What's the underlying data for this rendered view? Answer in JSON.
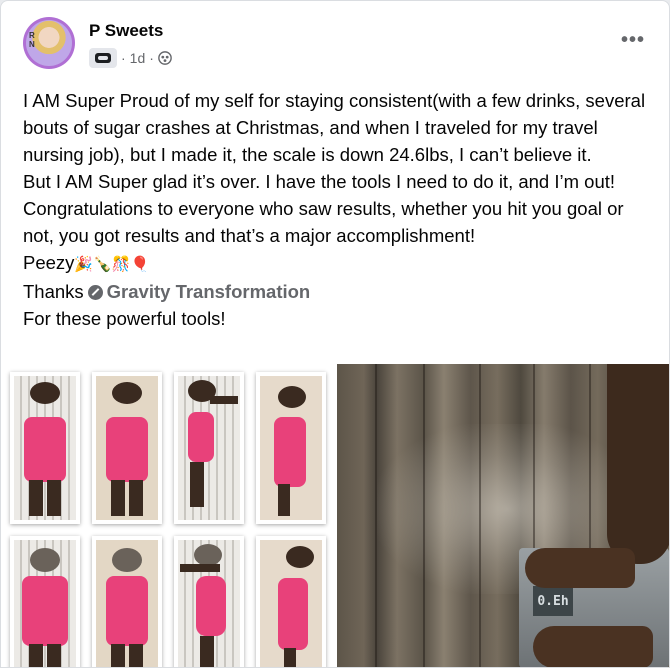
{
  "post": {
    "author": "P Sweets",
    "avatar_initials": "R\nN\nsweets",
    "time": "1d",
    "separator": "·",
    "more_label": "•••",
    "paragraphs": [
      "I AM Super Proud of my self for staying consistent(with a few drinks, several bouts of sugar crashes at Christmas, and when I traveled for my travel nursing job), but I made it, the scale is down 24.6lbs, I can’t believe it.",
      "But I AM Super glad it’s over. I have the tools I need to do it, and I’m out! Congratulations to everyone who saw results, whether you hit you goal or not, you got results and that’s a major accomplishment!"
    ],
    "peezy_text": "Peezy",
    "peezy_emojis": "🎉🍾🎊🎈",
    "thanks_text": "Thanks",
    "tagged_page": "Gravity Transformation",
    "closing": "For these powerful tools!",
    "scale_reading": "0.Eh"
  },
  "colors": {
    "accent_avatar_ring": "#b06fd4",
    "meta_gray": "#65676b",
    "outfit_pink": "#e8417a"
  },
  "icons": [
    "group-badge-icon",
    "globe-icon",
    "more-options-icon",
    "verified-tag-icon"
  ]
}
